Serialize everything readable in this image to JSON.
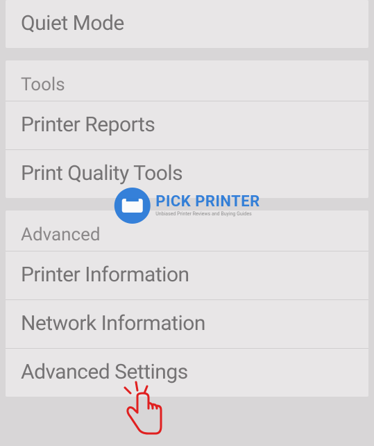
{
  "sections": [
    {
      "items": [
        {
          "label": "Quiet Mode"
        }
      ]
    },
    {
      "header": "Tools",
      "items": [
        {
          "label": "Printer Reports"
        },
        {
          "label": "Print Quality Tools"
        }
      ]
    },
    {
      "header": "Advanced",
      "items": [
        {
          "label": "Printer Information"
        },
        {
          "label": "Network Information"
        },
        {
          "label": "Advanced Settings"
        }
      ]
    }
  ],
  "watermark": {
    "title": "PICK PRINTER",
    "subtitle": "Unbiased Printer Reviews and Buying Guides"
  }
}
